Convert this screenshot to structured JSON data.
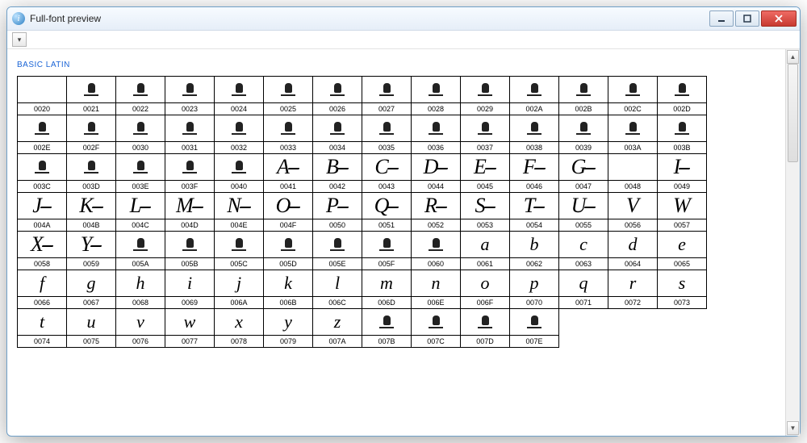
{
  "window": {
    "title": "Full-font preview"
  },
  "section_title": "BASIC LATIN",
  "columns": 14,
  "glyphs": [
    {
      "code": "0020",
      "kind": "blank"
    },
    {
      "code": "0021",
      "kind": "notdef"
    },
    {
      "code": "0022",
      "kind": "notdef"
    },
    {
      "code": "0023",
      "kind": "notdef"
    },
    {
      "code": "0024",
      "kind": "notdef"
    },
    {
      "code": "0025",
      "kind": "notdef"
    },
    {
      "code": "0026",
      "kind": "notdef"
    },
    {
      "code": "0027",
      "kind": "notdef"
    },
    {
      "code": "0028",
      "kind": "notdef"
    },
    {
      "code": "0029",
      "kind": "notdef"
    },
    {
      "code": "002A",
      "kind": "notdef"
    },
    {
      "code": "002B",
      "kind": "notdef"
    },
    {
      "code": "002C",
      "kind": "notdef"
    },
    {
      "code": "002D",
      "kind": "notdef"
    },
    {
      "code": "002E",
      "kind": "notdef"
    },
    {
      "code": "002F",
      "kind": "notdef"
    },
    {
      "code": "0030",
      "kind": "notdef"
    },
    {
      "code": "0031",
      "kind": "notdef"
    },
    {
      "code": "0032",
      "kind": "notdef"
    },
    {
      "code": "0033",
      "kind": "notdef"
    },
    {
      "code": "0034",
      "kind": "notdef"
    },
    {
      "code": "0035",
      "kind": "notdef"
    },
    {
      "code": "0036",
      "kind": "notdef"
    },
    {
      "code": "0037",
      "kind": "notdef"
    },
    {
      "code": "0038",
      "kind": "notdef"
    },
    {
      "code": "0039",
      "kind": "notdef"
    },
    {
      "code": "003A",
      "kind": "notdef"
    },
    {
      "code": "003B",
      "kind": "notdef"
    },
    {
      "code": "003C",
      "kind": "notdef"
    },
    {
      "code": "003D",
      "kind": "notdef"
    },
    {
      "code": "003E",
      "kind": "notdef"
    },
    {
      "code": "003F",
      "kind": "notdef"
    },
    {
      "code": "0040",
      "kind": "notdef"
    },
    {
      "code": "0041",
      "kind": "letter",
      "ch": "A",
      "case": "upper",
      "swash": true
    },
    {
      "code": "0042",
      "kind": "letter",
      "ch": "B",
      "case": "upper",
      "swash": true
    },
    {
      "code": "0043",
      "kind": "letter",
      "ch": "C",
      "case": "upper",
      "swash": true
    },
    {
      "code": "0044",
      "kind": "letter",
      "ch": "D",
      "case": "upper",
      "swash": true
    },
    {
      "code": "0045",
      "kind": "letter",
      "ch": "E",
      "case": "upper",
      "swash": true
    },
    {
      "code": "0046",
      "kind": "letter",
      "ch": "F",
      "case": "upper",
      "swash": true
    },
    {
      "code": "0047",
      "kind": "letter",
      "ch": "G",
      "case": "upper",
      "swash": true
    },
    {
      "code": "0048",
      "kind": "blank"
    },
    {
      "code": "0049",
      "kind": "letter",
      "ch": "I",
      "case": "upper",
      "swash": true
    },
    {
      "code": "004A",
      "kind": "letter",
      "ch": "J",
      "case": "upper",
      "swash": true
    },
    {
      "code": "004B",
      "kind": "letter",
      "ch": "K",
      "case": "upper",
      "swash": true
    },
    {
      "code": "004C",
      "kind": "letter",
      "ch": "L",
      "case": "upper",
      "swash": true
    },
    {
      "code": "004D",
      "kind": "letter",
      "ch": "M",
      "case": "upper",
      "swash": true
    },
    {
      "code": "004E",
      "kind": "letter",
      "ch": "N",
      "case": "upper",
      "swash": true
    },
    {
      "code": "004F",
      "kind": "letter",
      "ch": "O",
      "case": "upper",
      "swash": true
    },
    {
      "code": "0050",
      "kind": "letter",
      "ch": "P",
      "case": "upper",
      "swash": true
    },
    {
      "code": "0051",
      "kind": "letter",
      "ch": "Q",
      "case": "upper",
      "swash": true
    },
    {
      "code": "0052",
      "kind": "letter",
      "ch": "R",
      "case": "upper",
      "swash": true
    },
    {
      "code": "0053",
      "kind": "letter",
      "ch": "S",
      "case": "upper",
      "swash": true
    },
    {
      "code": "0054",
      "kind": "letter",
      "ch": "T",
      "case": "upper",
      "swash": true
    },
    {
      "code": "0055",
      "kind": "letter",
      "ch": "U",
      "case": "upper",
      "swash": true
    },
    {
      "code": "0056",
      "kind": "letter",
      "ch": "V",
      "case": "upper"
    },
    {
      "code": "0057",
      "kind": "letter",
      "ch": "W",
      "case": "upper"
    },
    {
      "code": "0058",
      "kind": "letter",
      "ch": "X",
      "case": "upper",
      "swash": true
    },
    {
      "code": "0059",
      "kind": "letter",
      "ch": "Y",
      "case": "upper",
      "swash": true
    },
    {
      "code": "005A",
      "kind": "notdef"
    },
    {
      "code": "005B",
      "kind": "notdef"
    },
    {
      "code": "005C",
      "kind": "notdef"
    },
    {
      "code": "005D",
      "kind": "notdef"
    },
    {
      "code": "005E",
      "kind": "notdef"
    },
    {
      "code": "005F",
      "kind": "notdef"
    },
    {
      "code": "0060",
      "kind": "notdef"
    },
    {
      "code": "0061",
      "kind": "letter",
      "ch": "a",
      "case": "lower"
    },
    {
      "code": "0062",
      "kind": "letter",
      "ch": "b",
      "case": "lower"
    },
    {
      "code": "0063",
      "kind": "letter",
      "ch": "c",
      "case": "lower"
    },
    {
      "code": "0064",
      "kind": "letter",
      "ch": "d",
      "case": "lower"
    },
    {
      "code": "0065",
      "kind": "letter",
      "ch": "e",
      "case": "lower"
    },
    {
      "code": "0066",
      "kind": "letter",
      "ch": "f",
      "case": "lower"
    },
    {
      "code": "0067",
      "kind": "letter",
      "ch": "g",
      "case": "lower"
    },
    {
      "code": "0068",
      "kind": "letter",
      "ch": "h",
      "case": "lower"
    },
    {
      "code": "0069",
      "kind": "letter",
      "ch": "i",
      "case": "lower"
    },
    {
      "code": "006A",
      "kind": "letter",
      "ch": "j",
      "case": "lower"
    },
    {
      "code": "006B",
      "kind": "letter",
      "ch": "k",
      "case": "lower"
    },
    {
      "code": "006C",
      "kind": "letter",
      "ch": "l",
      "case": "lower"
    },
    {
      "code": "006D",
      "kind": "letter",
      "ch": "m",
      "case": "lower"
    },
    {
      "code": "006E",
      "kind": "letter",
      "ch": "n",
      "case": "lower"
    },
    {
      "code": "006F",
      "kind": "letter",
      "ch": "o",
      "case": "lower"
    },
    {
      "code": "0070",
      "kind": "letter",
      "ch": "p",
      "case": "lower"
    },
    {
      "code": "0071",
      "kind": "letter",
      "ch": "q",
      "case": "lower"
    },
    {
      "code": "0072",
      "kind": "letter",
      "ch": "r",
      "case": "lower"
    },
    {
      "code": "0073",
      "kind": "letter",
      "ch": "s",
      "case": "lower"
    },
    {
      "code": "0074",
      "kind": "letter",
      "ch": "t",
      "case": "lower"
    },
    {
      "code": "0075",
      "kind": "letter",
      "ch": "u",
      "case": "lower"
    },
    {
      "code": "0076",
      "kind": "letter",
      "ch": "v",
      "case": "lower"
    },
    {
      "code": "0077",
      "kind": "letter",
      "ch": "w",
      "case": "lower"
    },
    {
      "code": "0078",
      "kind": "letter",
      "ch": "x",
      "case": "lower"
    },
    {
      "code": "0079",
      "kind": "letter",
      "ch": "y",
      "case": "lower"
    },
    {
      "code": "007A",
      "kind": "letter",
      "ch": "z",
      "case": "lower"
    },
    {
      "code": "007B",
      "kind": "notdef"
    },
    {
      "code": "007C",
      "kind": "notdef"
    },
    {
      "code": "007D",
      "kind": "notdef"
    },
    {
      "code": "007E",
      "kind": "notdef"
    }
  ]
}
